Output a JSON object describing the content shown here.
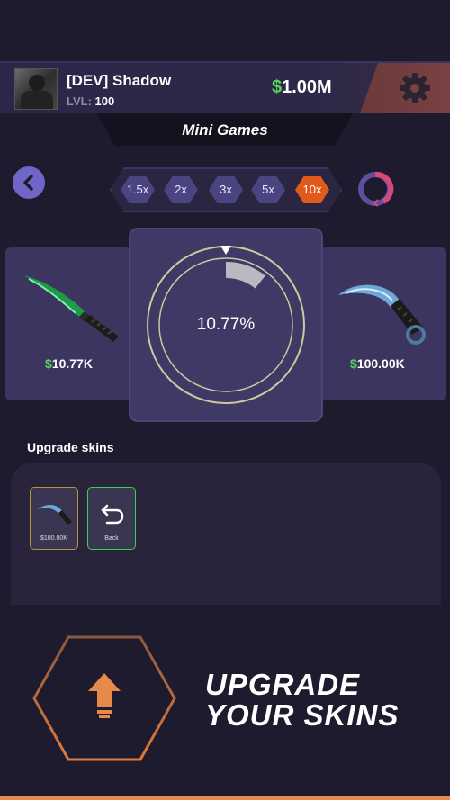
{
  "header": {
    "username": "[DEV] Shadow",
    "level_label": "LVL:",
    "level_value": "100",
    "balance_symbol": "$",
    "balance_value": "1.00M",
    "settings_icon": "gear-icon"
  },
  "page_title": "Mini Games",
  "multipliers": [
    "1.5x",
    "2x",
    "3x",
    "5x",
    "10x"
  ],
  "active_multiplier": "10x",
  "upgrade": {
    "chance": "10.77%",
    "chance_fraction": 0.1077,
    "from_item": {
      "symbol": "$",
      "price": "10.77K",
      "name": "bayonet-knife"
    },
    "to_item": {
      "symbol": "$",
      "price": "100.00K",
      "name": "karambit-knife"
    }
  },
  "inventory": {
    "title": "Upgrade skins",
    "items": [
      {
        "label": "$100.00K"
      },
      {
        "label": "Back"
      }
    ]
  },
  "cta": {
    "line1": "UPGRADE",
    "line2": "YOUR SKINS"
  },
  "colors": {
    "accent_green": "#55d45a",
    "accent_orange": "#e05a1c",
    "background": "#1f1b2e"
  }
}
